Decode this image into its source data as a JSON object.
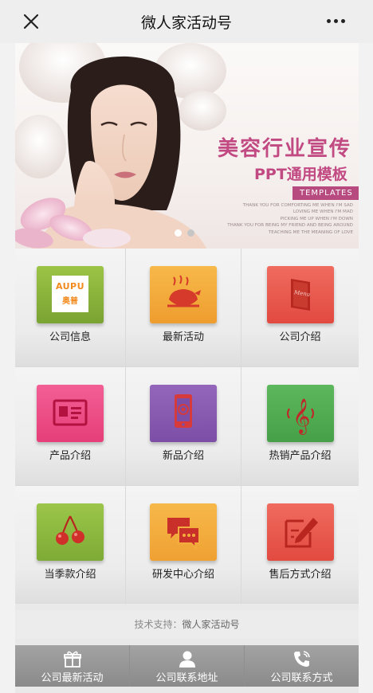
{
  "navbar": {
    "title": "微人家活动号"
  },
  "banner": {
    "title": "美容行业宣传",
    "subtitle": "PPT通用模板",
    "tag": "TEMPLATES",
    "quotes": [
      "THANK YOU FOR COMFORTING ME WHEN I'M SAD",
      "LOVING ME WHEN I'M MAD",
      "PICKING ME UP WHEN I'M DOWN",
      "THANK YOU FOR BEING MY FRIEND AND BEING AROUND",
      "TEACHING ME THE MEANING OF LOVE"
    ],
    "slide_count": 2,
    "active_slide": 1
  },
  "grid": {
    "items": [
      {
        "label": "公司信息",
        "icon": "aupu-logo-icon",
        "logo_text_top": "AUPU",
        "logo_text_bottom": "奥普",
        "color": "#8cb43c"
      },
      {
        "label": "最新活动",
        "icon": "roast-chicken-icon",
        "color": "#f2a93b"
      },
      {
        "label": "公司介绍",
        "icon": "menu-book-icon",
        "color": "#ea5a4e"
      },
      {
        "label": "产品介绍",
        "icon": "id-card-icon",
        "color": "#ec4f86"
      },
      {
        "label": "新品介绍",
        "icon": "smartphone-icon",
        "color": "#8a5bb0"
      },
      {
        "label": "热销产品介绍",
        "icon": "treble-clef-icon",
        "color": "#52a953"
      },
      {
        "label": "当季款介绍",
        "icon": "cherries-icon",
        "color": "#8bbb3f"
      },
      {
        "label": "研发中心介绍",
        "icon": "chat-bubbles-icon",
        "color": "#f3ad3d"
      },
      {
        "label": "售后方式介绍",
        "icon": "edit-note-icon",
        "color": "#ec5b4f"
      }
    ]
  },
  "footer": {
    "support_label": "技术支持：",
    "support_value": "微人家活动号"
  },
  "tabbar": {
    "items": [
      {
        "label": "公司最新活动",
        "icon": "gift-icon"
      },
      {
        "label": "公司联系地址",
        "icon": "person-icon"
      },
      {
        "label": "公司联系方式",
        "icon": "phone-icon"
      }
    ]
  }
}
